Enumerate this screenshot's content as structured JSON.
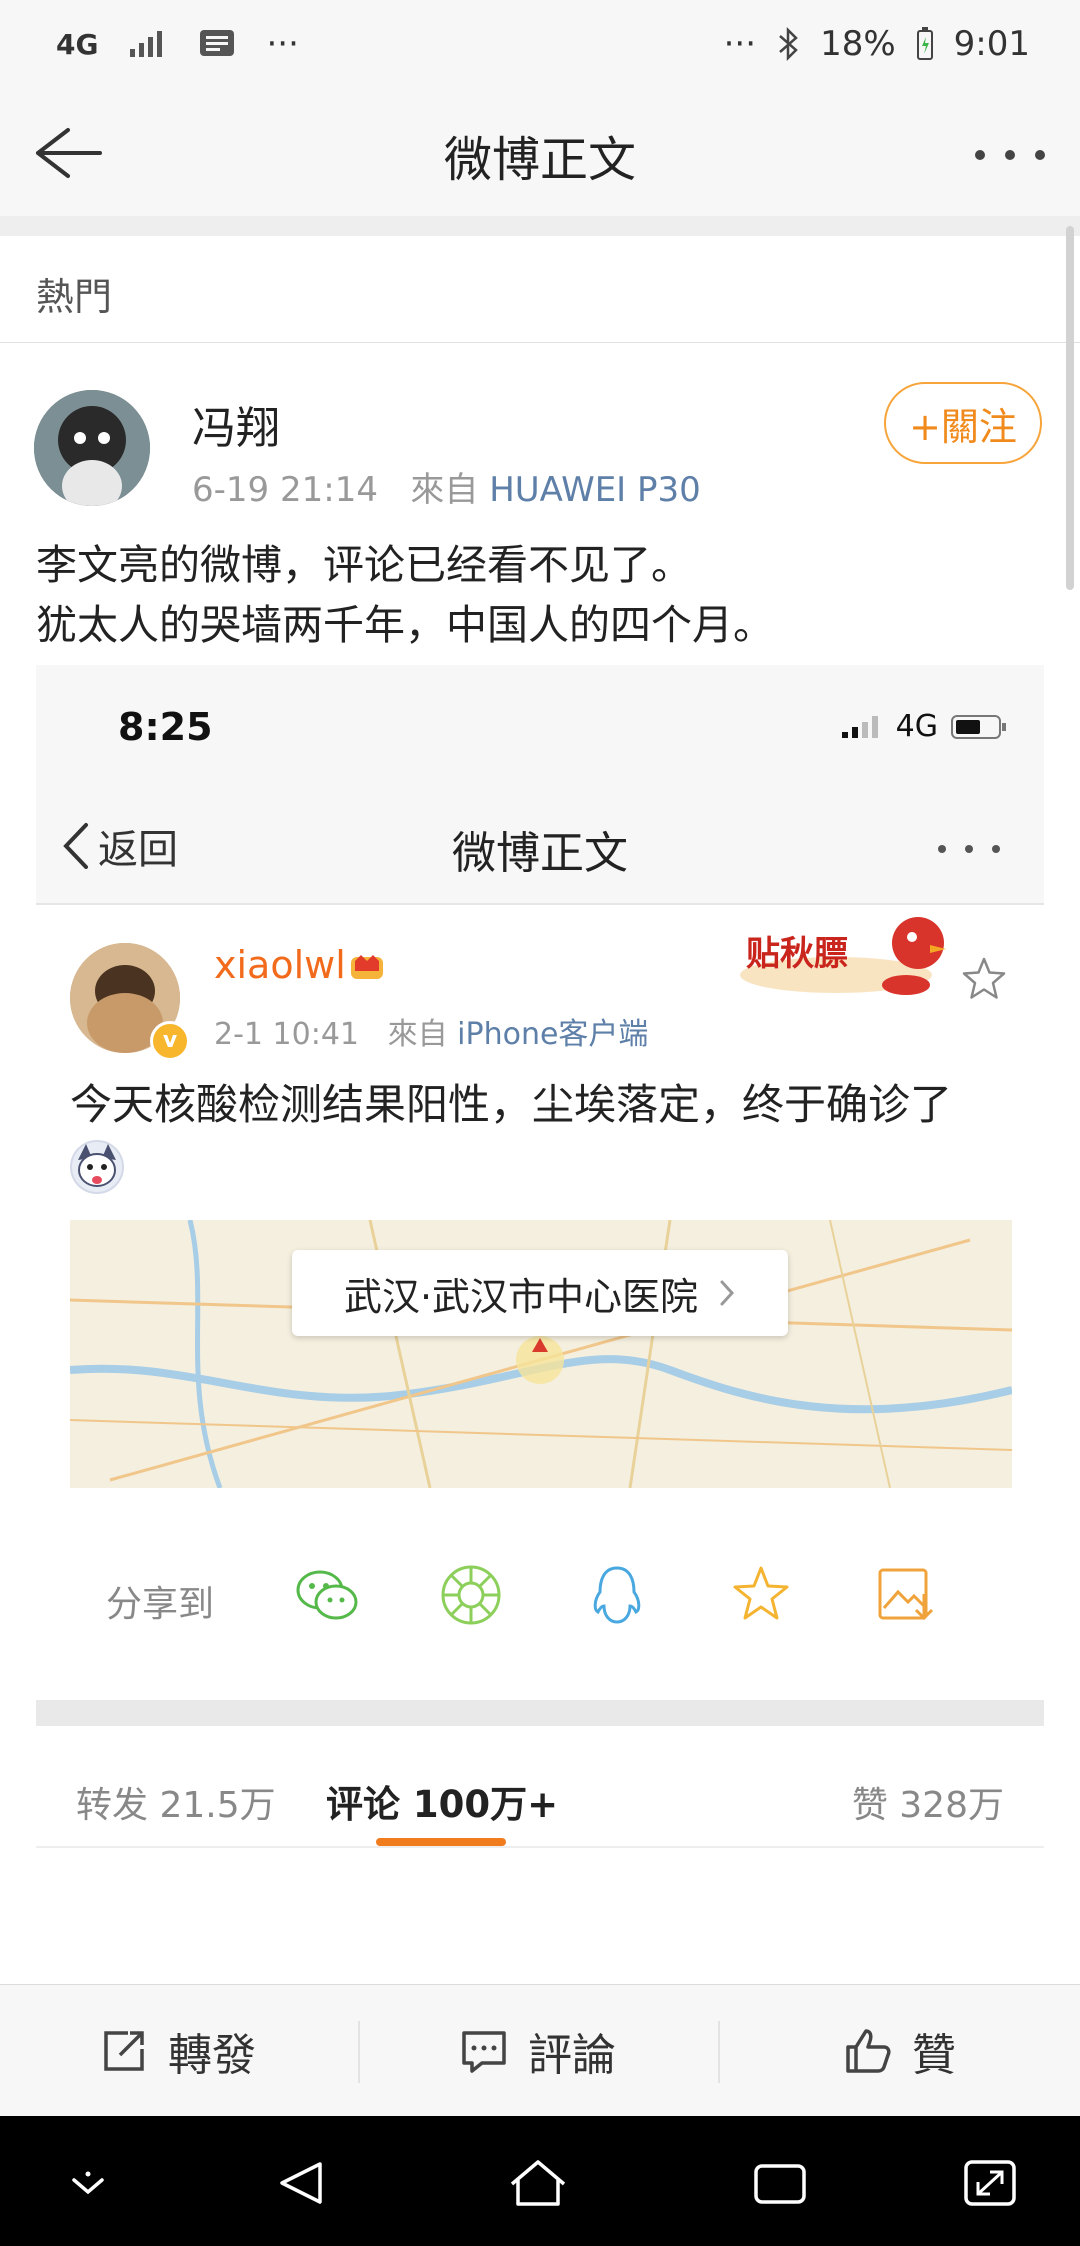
{
  "status_bar": {
    "network": "4G",
    "battery": "18%",
    "time": "9:01",
    "dots_left": "···",
    "dots_right": "···"
  },
  "nav": {
    "title": "微博正文"
  },
  "section": {
    "label": "熱門"
  },
  "post": {
    "author": "冯翔",
    "time": "6-19 21:14",
    "from_label": "來自",
    "source": "HUAWEI P30",
    "follow_label": "+關注",
    "text_lines": [
      "李文亮的微博，评论已经看不见了。",
      "犹太人的哭墙两千年，中国人的四个月。"
    ]
  },
  "embedded": {
    "status_time": "8:25",
    "status_net": "4G",
    "back_label": "返回",
    "title": "微博正文",
    "username": "xiaolwl",
    "time": "2-1 10:41",
    "from_label": "來自",
    "source": "iPhone客户端",
    "sticker_text": "贴秋膘",
    "text": "今天核酸检测结果阳性，尘埃落定，终于确诊了",
    "location": "武汉·武汉市中心医院",
    "share_label": "分享到",
    "stats": {
      "repost_label": "转发",
      "repost_count": "21.5万",
      "comment_label": "评论",
      "comment_count": "100万+",
      "like_label": "赞",
      "like_count": "328万"
    }
  },
  "actions": {
    "repost": "轉發",
    "comment": "評論",
    "like": "贊"
  },
  "colors": {
    "accent_orange": "#f08a1c",
    "link_blue": "#5d7fa8",
    "username_orange": "#f26b1d"
  }
}
